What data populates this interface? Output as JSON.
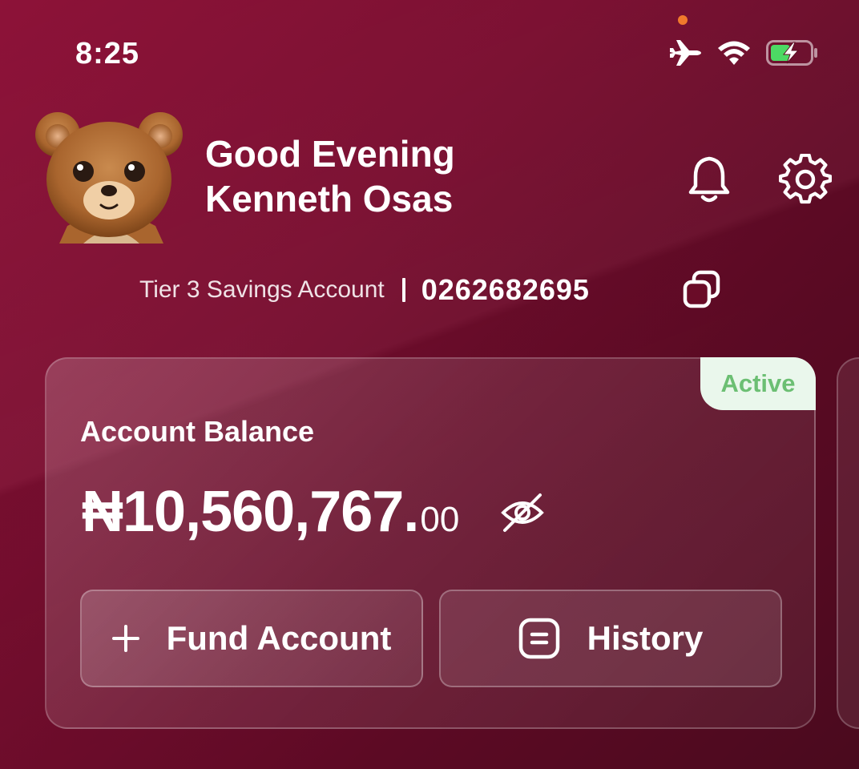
{
  "status_bar": {
    "time": "8:25",
    "icons": [
      "airplane-icon",
      "wifi-icon",
      "battery-charging-icon"
    ],
    "recording_dot_color": "#f07a2c"
  },
  "header": {
    "greeting": "Good Evening",
    "user_name": "Kenneth Osas",
    "avatar": "teddy-bear-avatar",
    "actions": [
      "bell-icon",
      "gear-icon"
    ]
  },
  "account": {
    "tier_label": "Tier 3 Savings Account",
    "account_number": "0262682695",
    "copy_icon": "copy-icon"
  },
  "balance_card": {
    "status": "Active",
    "label": "Account Balance",
    "amount_main": "₦10,560,767.",
    "amount_decimal": "00",
    "visibility_icon": "eye-off-icon",
    "fund_button": "Fund Account",
    "history_button": "History"
  },
  "colors": {
    "background": "#7a0e30",
    "active_badge_bg": "#eaf7ec",
    "active_badge_text": "#6cbf73"
  }
}
